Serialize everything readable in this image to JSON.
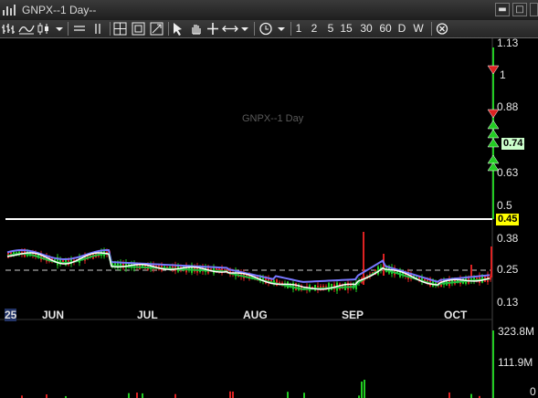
{
  "window": {
    "title": "GNPX--1 Day--",
    "minimize_label": "▬",
    "restore_label": "□",
    "close_label": "✕"
  },
  "toolbar": {
    "intervals": [
      "1",
      "2",
      "5",
      "15",
      "30",
      "60",
      "D",
      "W"
    ]
  },
  "chart": {
    "watermark": "GNPX--1 Day",
    "price_axis": [
      "1.13",
      "1",
      "0.88",
      "0.74",
      "0.63",
      "0.5",
      "0.45",
      "0.38",
      "0.25",
      "0.13"
    ],
    "last_price_tag": "0.74",
    "current_price_tag": "0.45",
    "volume_axis": [
      "323.8M",
      "111.9M",
      "0"
    ],
    "months": [
      "25",
      "JUN",
      "JUL",
      "AUG",
      "SEP",
      "OCT"
    ],
    "colors": {
      "up": "#22cc22",
      "down": "#dd2222",
      "ma_fast": "#ffffff",
      "ma_mid": "#1fbf3f",
      "ma_slow": "#7777ff",
      "price_line": "#ffffff",
      "tag_bg": "#ffff00"
    }
  }
}
